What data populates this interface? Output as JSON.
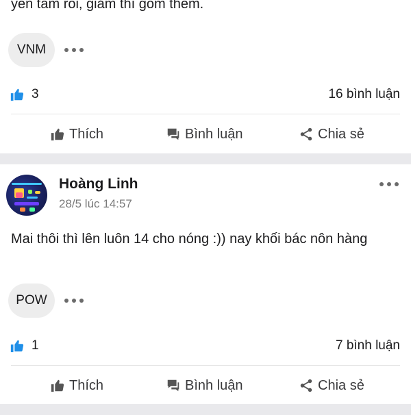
{
  "previous_post": {
    "text_tail": "yên tâm rồi, giảm thì gom thêm.",
    "ticker": "VNM",
    "likes": "3",
    "comments": "16 bình luận"
  },
  "post": {
    "author": "Hoàng Linh",
    "time": "28/5 lúc 14:57",
    "text": "Mai thôi thì lên luôn 14 cho nóng :)) nay khối bác nôn hàng",
    "ticker": "POW",
    "likes": "1",
    "comments": "7 bình luận"
  },
  "actions": {
    "like": "Thích",
    "comment": "Bình luận",
    "share": "Chia sẻ"
  },
  "colors": {
    "like_blue": "#1f8fe8",
    "separator": "#e9e9ec",
    "pill": "#ededed"
  },
  "icons": [
    "like-icon",
    "thumb-icon",
    "comment-icon",
    "share-icon",
    "more-icon"
  ]
}
